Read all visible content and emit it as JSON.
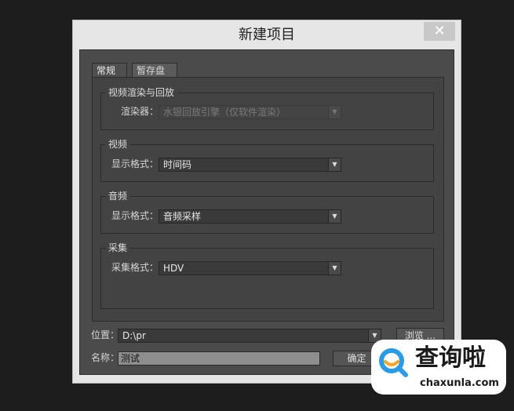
{
  "dialog": {
    "title": "新建项目",
    "close_label": "✕"
  },
  "tabs": [
    {
      "label": "常规",
      "active": true
    },
    {
      "label": "暂存盘",
      "active": false
    }
  ],
  "groups": {
    "render": {
      "title": "视频渲染与回放",
      "renderer_label": "渲染器：",
      "renderer_value": "水银回放引擎（仅软件渲染）",
      "disabled": true
    },
    "video": {
      "title": "视频",
      "format_label": "显示格式：",
      "format_value": "时间码"
    },
    "audio": {
      "title": "音频",
      "format_label": "显示格式：",
      "format_value": "音频采样"
    },
    "capture": {
      "title": "采集",
      "format_label": "采集格式：",
      "format_value": "HDV"
    }
  },
  "location": {
    "label": "位置：",
    "value": "D:\\pr"
  },
  "browse_label": "浏览 ...",
  "name": {
    "label": "名称：",
    "value": "测试"
  },
  "ok_label": "确定",
  "watermark": {
    "text": "查询啦",
    "url": "chaxunla.com"
  },
  "colors": {
    "dialog_frame": "#e6e6e6",
    "panel_bg": "#434343",
    "field_bg": "#3a3a3a",
    "watermark_accent": "#2b9be8",
    "watermark_orange": "#f5a623"
  }
}
